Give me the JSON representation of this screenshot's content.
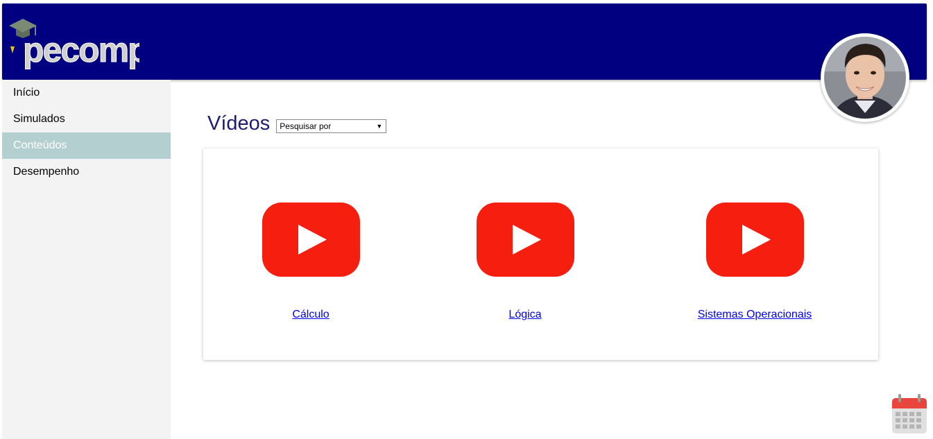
{
  "header": {
    "logo_text": "pecomp",
    "logo_icon": "graduation-cap-icon"
  },
  "user": {
    "avatar": "user-avatar"
  },
  "sidebar": {
    "items": [
      {
        "label": "Início",
        "active": false
      },
      {
        "label": "Simulados",
        "active": false
      },
      {
        "label": "Conteúdos",
        "active": true
      },
      {
        "label": "Desempenho",
        "active": false
      }
    ]
  },
  "main": {
    "title": "Vídeos",
    "search_select": {
      "selected": "Pesquisar por"
    },
    "videos": [
      {
        "label": "Cálculo",
        "icon": "youtube-play-icon"
      },
      {
        "label": "Lógica",
        "icon": "youtube-play-icon"
      },
      {
        "label": "Sistemas Operacionais",
        "icon": "youtube-play-icon"
      }
    ]
  },
  "colors": {
    "header_bg": "#000080",
    "sidebar_bg": "#f3f3f3",
    "sidebar_active_bg": "#b3cfd0",
    "youtube_red": "#f51e0f",
    "title_color": "#1c1c6e"
  },
  "calendar_icon": "calendar-icon"
}
